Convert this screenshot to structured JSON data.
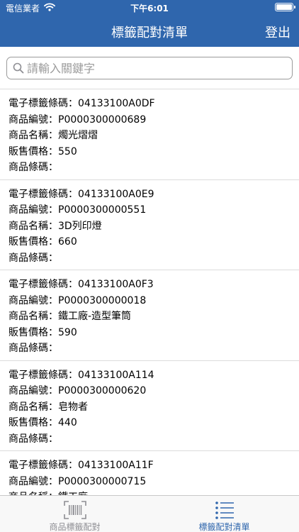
{
  "status_bar": {
    "carrier": "電信業者",
    "time": "下午6:01"
  },
  "nav": {
    "title": "標籤配對清單",
    "logout_label": "登出"
  },
  "search": {
    "placeholder": "請輸入關鍵字",
    "value": ""
  },
  "items": [
    {
      "tag_line": "電子標籤條碼：04133100A0DF",
      "product_no_line": "商品編號：P0000300000689",
      "name_line": "商品名稱：燭光熠熠",
      "price_line": "販售價格：550",
      "barcode_line": "商品條碼："
    },
    {
      "tag_line": "電子標籤條碼：04133100A0E9",
      "product_no_line": "商品編號：P0000300000551",
      "name_line": "商品名稱：3D列印燈",
      "price_line": "販售價格：660",
      "barcode_line": "商品條碼："
    },
    {
      "tag_line": "電子標籤條碼：04133100A0F3",
      "product_no_line": "商品編號：P0000300000018",
      "name_line": "商品名稱：鐵工廠-造型筆筒",
      "price_line": "販售價格：590",
      "barcode_line": "商品條碼："
    },
    {
      "tag_line": "電子標籤條碼：04133100A114",
      "product_no_line": "商品編號：P0000300000620",
      "name_line": "商品名稱：皂物者",
      "price_line": "販售價格：440",
      "barcode_line": "商品條碼："
    },
    {
      "tag_line": "電子標籤條碼：04133100A11F",
      "product_no_line": "商品編號：P0000300000715",
      "name_line": "商品名稱：鐵工廠",
      "price_line": "",
      "barcode_line": ""
    }
  ],
  "tabs": [
    {
      "label": "商品標籤配對",
      "icon": "barcode-scan-icon",
      "active": false
    },
    {
      "label": "標籤配對清單",
      "icon": "list-icon",
      "active": true
    }
  ],
  "colors": {
    "accent": "#2f66ad",
    "separator": "#dcdcdc",
    "inactive_tab": "#8e8e93"
  }
}
